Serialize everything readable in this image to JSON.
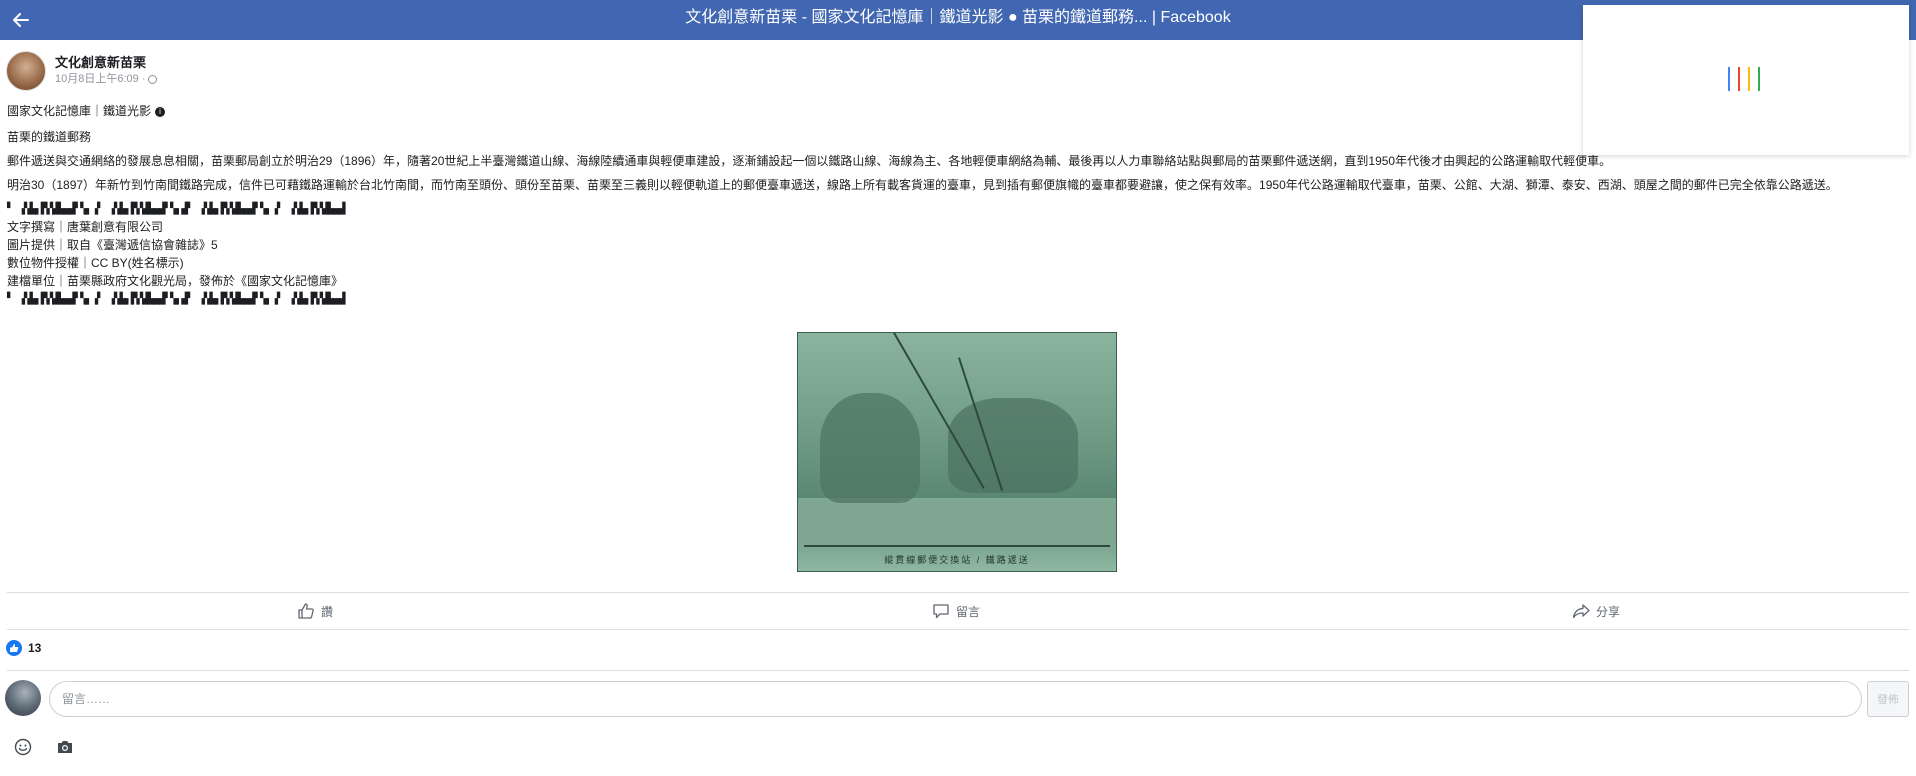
{
  "header": {
    "title": "文化創意新苗栗 - 國家文化記憶庫｜鐵道光影 ● 苗栗的鐵道郵務... | Facebook",
    "back_icon": "arrow-left-icon"
  },
  "loading_panel": {
    "spinner_colors": [
      "#4285f4",
      "#ea4335",
      "#fbbc05",
      "#34a853"
    ]
  },
  "post": {
    "author": "文化創意新苗栗",
    "timestamp": "10月8日上午6:09 ·",
    "privacy_icon": "globe-icon",
    "lines": {
      "series": "國家文化記憶庫｜鐵道光影",
      "headline": "苗栗的鐵道郵務",
      "paragraph1": "郵件遞送與交通網絡的發展息息相關，苗栗郵局創立於明治29（1896）年，隨著20世紀上半臺灣鐵道山線、海線陸續通車與輕便車建設，逐漸鋪設起一個以鐵路山線、海線為主、各地輕便車網絡為輔、最後再以人力車聯絡站點與郵局的苗栗郵件遞送網，直到1950年代後才由興起的公路運輸取代輕便車。",
      "paragraph2": "明治30（1897）年新竹到竹南間鐵路完成，信件已可藉鐵路運輸於台北竹南間，而竹南至頭份、頭份至苗栗、苗栗至三義則以輕便軌道上的郵便臺車遞送，線路上所有載客貨運的臺車，見到插有郵便旗幟的臺車都要避讓，使之保有效率。1950年代公路運輸取代臺車，苗栗、公館、大湖、獅潭、泰安、西湖、頭屋之間的郵件已完全依靠公路遞送。",
      "decor_top": "▘ ▗▚▙▖▛▞▟▙▄▟▘▚▖▗▘  ▗▚▙▖▛▞▟▙▄▟▘▚▖▟▘  ▗▚▙▖▛▞▟▙▄▟▘▚▖▗▘  ▗▚▙▖▛▞▟▙▄▟",
      "credit_text": "文字撰寫｜唐葉創意有限公司",
      "credit_image": "圖片提供｜取自《臺灣遞信協會雜誌》5",
      "credit_license": "數位物件授權｜CC BY(姓名標示)",
      "credit_org": "建檔單位｜苗栗縣政府文化觀光局，發佈於《國家文化記憶庫》",
      "decor_bottom": "▘ ▗▚▙▖▛▞▟▙▄▟▘▚▖▗▘  ▗▚▙▖▛▞▟▙▄▟▘▚▖▟▘  ▗▚▙▖▛▞▟▙▄▟▘▚▖▗▘  ▗▚▙▖▛▞▟▙▄▟"
    },
    "photo_caption": "縱貫線郵便交換站 / 鐵路遞送",
    "actions": {
      "like": "讚",
      "comment": "留言",
      "share": "分享"
    },
    "reaction_count": "13",
    "comment_placeholder": "留言……",
    "post_button": "發佈"
  },
  "theme": {
    "topbar_color": "#4267b2",
    "like_color": "#1877f2"
  }
}
